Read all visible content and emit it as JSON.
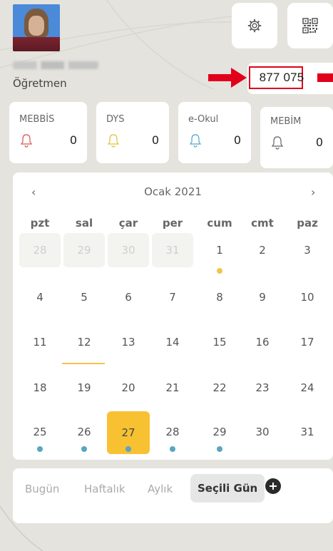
{
  "profile": {
    "role": "Öğretmen"
  },
  "header": {
    "settings_icon": "gear-icon",
    "qr_icon": "qr-code-icon",
    "number": "877 075"
  },
  "cards": [
    {
      "label": "MEBBİS",
      "count": "0",
      "bell_color": "#d9534f"
    },
    {
      "label": "DYS",
      "count": "0",
      "bell_color": "#e0c13c"
    },
    {
      "label": "e-Okul",
      "count": "0",
      "bell_color": "#4fa8c6"
    },
    {
      "label": "MEBİM",
      "count": "0",
      "bell_color": "#666666"
    }
  ],
  "calendar": {
    "month": "Ocak 2021",
    "prev": "‹",
    "next": "›",
    "weekdays": [
      "pzt",
      "sal",
      "çar",
      "per",
      "cum",
      "cmt",
      "paz"
    ],
    "weeks": [
      [
        "28",
        "29",
        "30",
        "31",
        "1",
        "2",
        "3"
      ],
      [
        "4",
        "5",
        "6",
        "7",
        "8",
        "9",
        "10"
      ],
      [
        "11",
        "12",
        "13",
        "14",
        "15",
        "16",
        "17"
      ],
      [
        "18",
        "19",
        "20",
        "21",
        "22",
        "23",
        "24"
      ],
      [
        "25",
        "26",
        "27",
        "28",
        "29",
        "30",
        "31"
      ]
    ],
    "selected_day": "27"
  },
  "tabs": {
    "items": [
      "Bugün",
      "Haftalık",
      "Aylık",
      "Seçili Gün"
    ],
    "active": "Seçili Gün"
  },
  "colors": {
    "accent": "#f7c132",
    "event_dot": "#58a6c0",
    "highlight": "#e0001b"
  }
}
